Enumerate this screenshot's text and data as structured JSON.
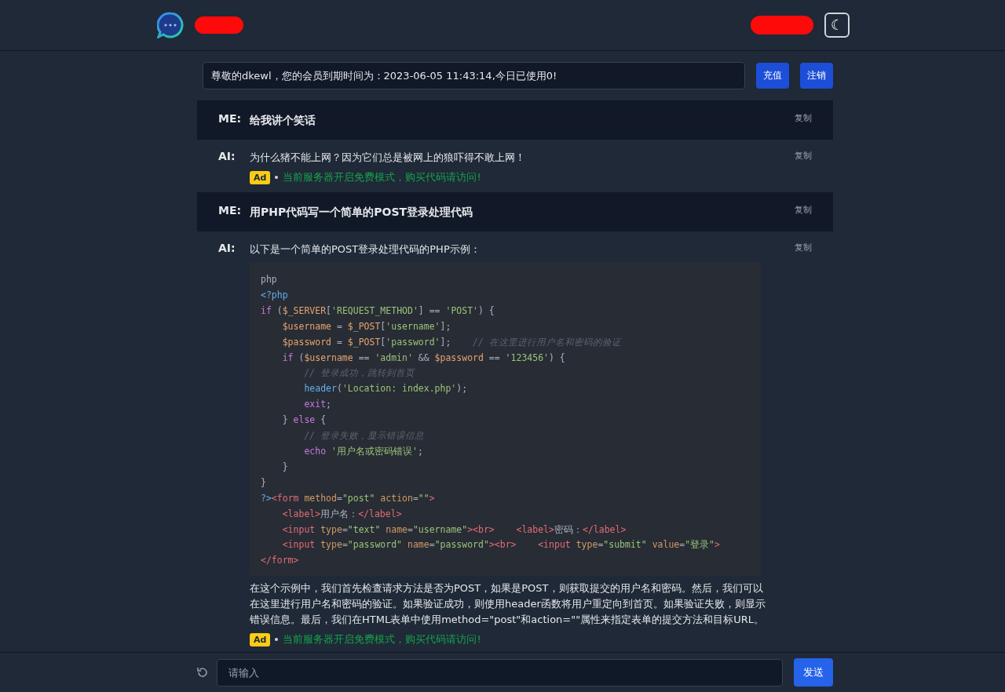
{
  "header": {
    "theme_toggle": "☾"
  },
  "notice": {
    "value": "尊敬的dkewl，您的会员到期时间为：2023-06-05 11:43:14,今日已使用0!",
    "buttons": [
      "充值",
      "注销"
    ]
  },
  "messages": [
    {
      "kind": "me",
      "label": "ME:",
      "text": "给我讲个笑话",
      "copy": "复制"
    },
    {
      "kind": "ai",
      "label": "AI:",
      "text": "为什么猪不能上网？因为它们总是被网上的狼吓得不敢上网！",
      "copy": "复制",
      "ad": {
        "badge": "Ad",
        "text": "当前服务器开启免费模式，购买代码请访问!"
      }
    },
    {
      "kind": "me",
      "label": "ME:",
      "text": "用PHP代码写一个简单的POST登录处理代码",
      "copy": "复制"
    },
    {
      "kind": "ai",
      "label": "AI:",
      "text": "以下是一个简单的POST登录处理代码的PHP示例：",
      "copy": "复制",
      "code": [
        [
          {
            "kind": "plain",
            "s": "php"
          }
        ],
        [
          {
            "kind": "meta",
            "s": "<?php"
          }
        ],
        [
          {
            "kind": "kw",
            "s": "if"
          },
          {
            "kind": "plain",
            "s": " ("
          },
          {
            "kind": "var",
            "s": "$_SERVER"
          },
          {
            "kind": "plain",
            "s": "["
          },
          {
            "kind": "str",
            "s": "'REQUEST_METHOD'"
          },
          {
            "kind": "plain",
            "s": "] == "
          },
          {
            "kind": "str",
            "s": "'POST'"
          },
          {
            "kind": "plain",
            "s": ") {"
          }
        ],
        [
          {
            "kind": "var",
            "s": "    $username"
          },
          {
            "kind": "plain",
            "s": " = "
          },
          {
            "kind": "var",
            "s": "$_POST"
          },
          {
            "kind": "plain",
            "s": "["
          },
          {
            "kind": "str",
            "s": "'username'"
          },
          {
            "kind": "plain",
            "s": "];"
          }
        ],
        [
          {
            "kind": "var",
            "s": "    $password"
          },
          {
            "kind": "plain",
            "s": " = "
          },
          {
            "kind": "var",
            "s": "$_POST"
          },
          {
            "kind": "plain",
            "s": "["
          },
          {
            "kind": "str",
            "s": "'password'"
          },
          {
            "kind": "plain",
            "s": "];    "
          },
          {
            "kind": "comment",
            "s": "// 在这里进行用户名和密码的验证"
          }
        ],
        [
          {
            "kind": "kw",
            "s": "    if"
          },
          {
            "kind": "plain",
            "s": " ("
          },
          {
            "kind": "var",
            "s": "$username"
          },
          {
            "kind": "plain",
            "s": " == "
          },
          {
            "kind": "str",
            "s": "'admin'"
          },
          {
            "kind": "plain",
            "s": " && "
          },
          {
            "kind": "var",
            "s": "$password"
          },
          {
            "kind": "plain",
            "s": " == "
          },
          {
            "kind": "str",
            "s": "'123456'"
          },
          {
            "kind": "plain",
            "s": ") {"
          }
        ],
        [
          {
            "kind": "comment",
            "s": "        // 登录成功，跳转到首页"
          }
        ],
        [
          {
            "kind": "fn",
            "s": "        header"
          },
          {
            "kind": "plain",
            "s": "("
          },
          {
            "kind": "str",
            "s": "'Location: index.php'"
          },
          {
            "kind": "plain",
            "s": ");"
          }
        ],
        [
          {
            "kind": "kw",
            "s": "        exit"
          },
          {
            "kind": "plain",
            "s": ";"
          }
        ],
        [
          {
            "kind": "plain",
            "s": "    } "
          },
          {
            "kind": "kw",
            "s": "else"
          },
          {
            "kind": "plain",
            "s": " {"
          }
        ],
        [
          {
            "kind": "comment",
            "s": "        // 登录失败，显示错误信息"
          }
        ],
        [
          {
            "kind": "kw",
            "s": "        echo "
          },
          {
            "kind": "str",
            "s": "'用户名或密码错误'"
          },
          {
            "kind": "plain",
            "s": ";"
          }
        ],
        [
          {
            "kind": "plain",
            "s": "    }"
          }
        ],
        [
          {
            "kind": "plain",
            "s": "}"
          }
        ],
        [
          {
            "kind": "meta",
            "s": "?>"
          },
          {
            "kind": "tag",
            "s": "<form"
          },
          {
            "kind": "attr",
            "s": " method"
          },
          {
            "kind": "plain",
            "s": "="
          },
          {
            "kind": "str",
            "s": "\"post\""
          },
          {
            "kind": "attr",
            "s": " action"
          },
          {
            "kind": "plain",
            "s": "="
          },
          {
            "kind": "str",
            "s": "\"\""
          },
          {
            "kind": "tag",
            "s": ">"
          }
        ],
        [
          {
            "kind": "tag",
            "s": "    <label>"
          },
          {
            "kind": "plain",
            "s": "用户名："
          },
          {
            "kind": "tag",
            "s": "</label>"
          }
        ],
        [
          {
            "kind": "tag",
            "s": "    <input"
          },
          {
            "kind": "attr",
            "s": " type"
          },
          {
            "kind": "plain",
            "s": "="
          },
          {
            "kind": "str",
            "s": "\"text\""
          },
          {
            "kind": "attr",
            "s": " name"
          },
          {
            "kind": "plain",
            "s": "="
          },
          {
            "kind": "str",
            "s": "\"username\""
          },
          {
            "kind": "tag",
            "s": "><br>"
          },
          {
            "kind": "tag",
            "s": "    <label>"
          },
          {
            "kind": "plain",
            "s": "密码："
          },
          {
            "kind": "tag",
            "s": "</label>"
          }
        ],
        [
          {
            "kind": "tag",
            "s": "    <input"
          },
          {
            "kind": "attr",
            "s": " type"
          },
          {
            "kind": "plain",
            "s": "="
          },
          {
            "kind": "str",
            "s": "\"password\""
          },
          {
            "kind": "attr",
            "s": " name"
          },
          {
            "kind": "plain",
            "s": "="
          },
          {
            "kind": "str",
            "s": "\"password\""
          },
          {
            "kind": "tag",
            "s": "><br>"
          },
          {
            "kind": "tag",
            "s": "    <input"
          },
          {
            "kind": "attr",
            "s": " type"
          },
          {
            "kind": "plain",
            "s": "="
          },
          {
            "kind": "str",
            "s": "\"submit\""
          },
          {
            "kind": "attr",
            "s": " value"
          },
          {
            "kind": "plain",
            "s": "="
          },
          {
            "kind": "str",
            "s": "\"登录\""
          },
          {
            "kind": "tag",
            "s": ">"
          }
        ],
        [
          {
            "kind": "tag",
            "s": "</form>"
          }
        ]
      ],
      "after": "在这个示例中，我们首先检查请求方法是否为POST，如果是POST，则获取提交的用户名和密码。然后，我们可以在这里进行用户名和密码的验证。如果验证成功，则使用header函数将用户重定向到首页。如果验证失败，则显示错误信息。最后，我们在HTML表单中使用method=\"post\"和action=\"\"属性来指定表单的提交方法和目标URL。",
      "ad": {
        "badge": "Ad",
        "text": "当前服务器开启免费模式，购买代码请访问!"
      }
    }
  ],
  "composer": {
    "placeholder": "请输入",
    "send": "发送"
  }
}
